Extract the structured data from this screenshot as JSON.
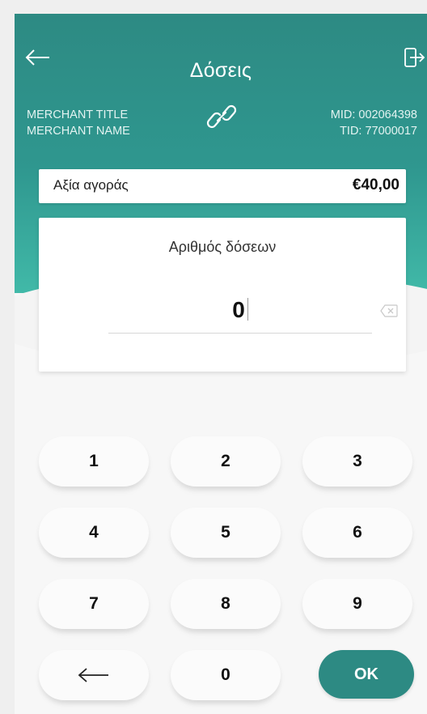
{
  "header": {
    "title": "Δόσεις",
    "back_icon": "arrow-left-icon",
    "exit_icon": "exit-door-icon"
  },
  "merchant": {
    "title": "MERCHANT TITLE",
    "name": "MERCHANT NAME",
    "mid": "MID: 002064398",
    "tid": "TID: 77000017",
    "link_icon": "link-icon"
  },
  "purchase": {
    "label": "Αξία αγοράς",
    "amount": "€40,00"
  },
  "installments": {
    "label": "Αριθμός δόσεων",
    "value": "0",
    "clear_icon": "backspace-clear-icon"
  },
  "keypad": {
    "keys": [
      "1",
      "2",
      "3",
      "4",
      "5",
      "6",
      "7",
      "8",
      "9"
    ],
    "zero": "0",
    "ok": "OK",
    "back_icon": "arrow-left-icon"
  },
  "colors": {
    "primary": "#2d8a83",
    "primary_light": "#41b9a8",
    "background": "#f7f7f7"
  }
}
